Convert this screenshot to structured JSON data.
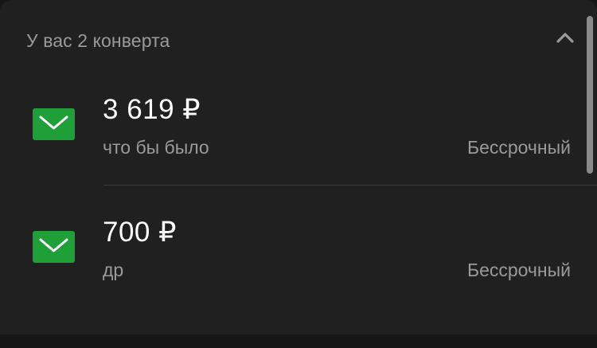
{
  "header": {
    "title": "У вас 2 конверта"
  },
  "colors": {
    "envelope_icon": "#1f9f38",
    "background": "#202020",
    "primary_text": "#ffffff",
    "secondary_text": "#9a9a9a"
  },
  "envelopes": [
    {
      "amount": "3 619 ₽",
      "name": "что бы было",
      "term": "Бессрочный",
      "icon": "envelope-icon"
    },
    {
      "amount": "700 ₽",
      "name": "др",
      "term": "Бессрочный",
      "icon": "envelope-icon"
    }
  ],
  "icons": {
    "collapse": "chevron-up-icon"
  }
}
